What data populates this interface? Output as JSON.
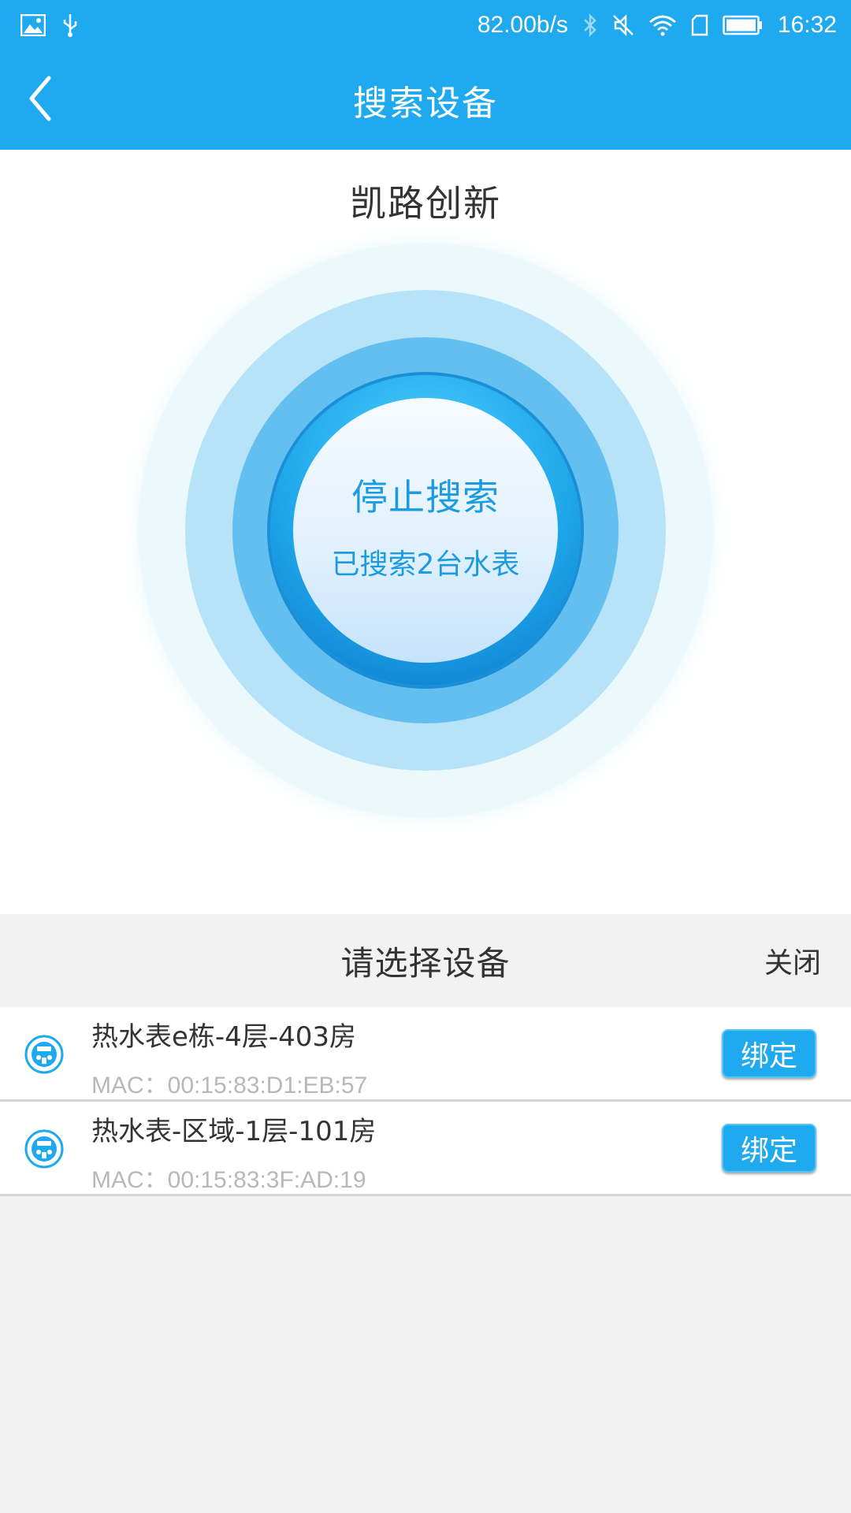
{
  "status_bar": {
    "net_speed": "82.00b/s",
    "time": "16:32",
    "icons": [
      "image-icon",
      "usb-icon",
      "bluetooth-icon",
      "mute-icon",
      "wifi-icon",
      "sim-icon",
      "battery-icon"
    ]
  },
  "header": {
    "title": "搜索设备",
    "back_icon": "chevron-left-icon"
  },
  "search": {
    "brand": "凯路创新",
    "stop_label": "停止搜索",
    "found_text": "已搜索2台水表"
  },
  "panel": {
    "title": "请选择设备",
    "close_label": "关闭"
  },
  "devices": [
    {
      "name": "热水表e栋-4层-403房",
      "mac": "MAC：00:15:83:D1:EB:57",
      "bind_label": "绑定",
      "icon": "water-meter-icon"
    },
    {
      "name": "热水表-区域-1层-101房",
      "mac": "MAC：00:15:83:3F:AD:19",
      "bind_label": "绑定",
      "icon": "water-meter-icon"
    }
  ],
  "colors": {
    "primary": "#1faaf0",
    "accent_text": "#1d9be0",
    "background": "#f2f2f2"
  }
}
